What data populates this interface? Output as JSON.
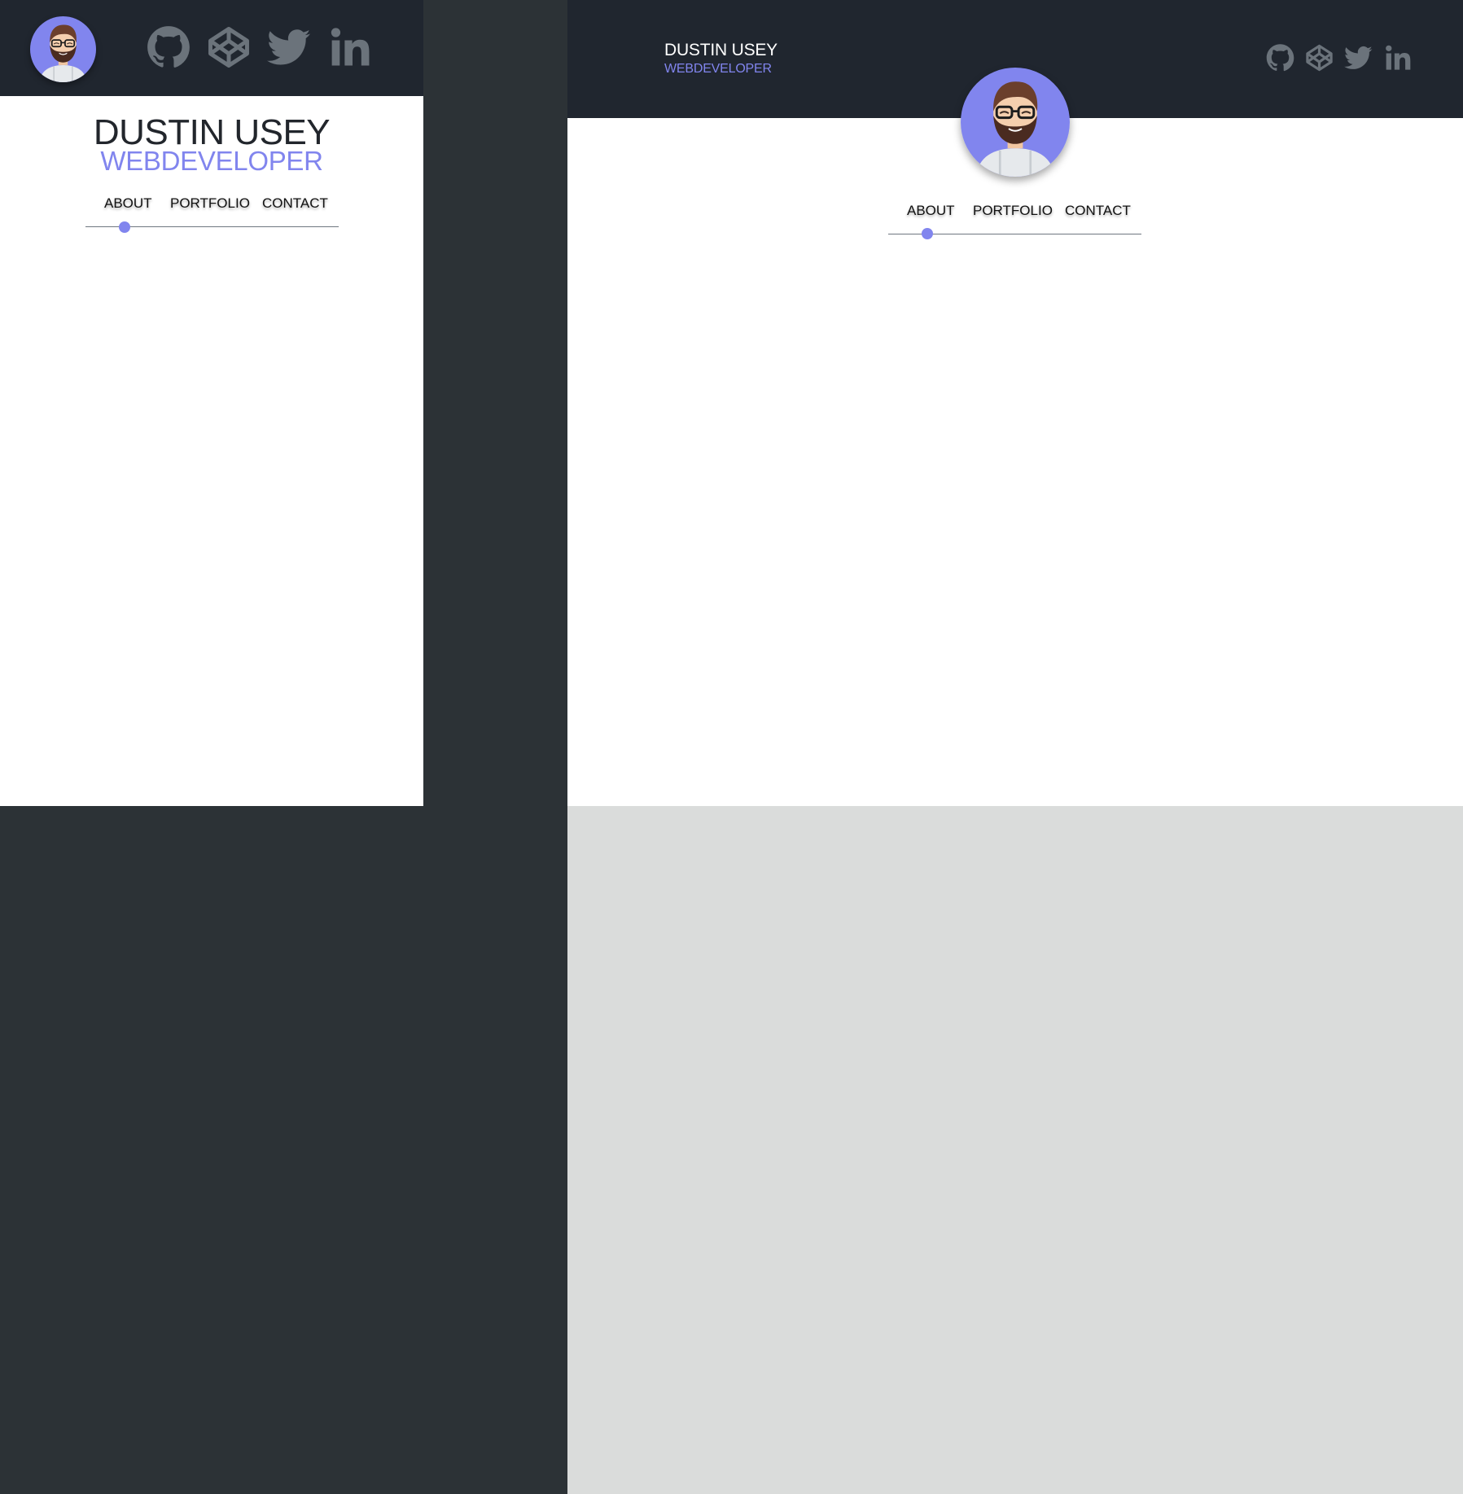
{
  "profile": {
    "name": "DUSTIN USEY",
    "role": "WEBDEVELOPER"
  },
  "nav": {
    "items": [
      "ABOUT",
      "PORTFOLIO",
      "CONTACT"
    ],
    "active_index": 0
  },
  "social_icons": [
    "github-icon",
    "codepen-icon",
    "twitter-icon",
    "linkedin-icon"
  ],
  "colors": {
    "header_bg": "#20262f",
    "page_bg": "#2c3236",
    "content_bg": "#ffffff",
    "footer_bg": "#dadcdb",
    "accent": "#8185ee",
    "icon_gray": "#6b737b"
  }
}
